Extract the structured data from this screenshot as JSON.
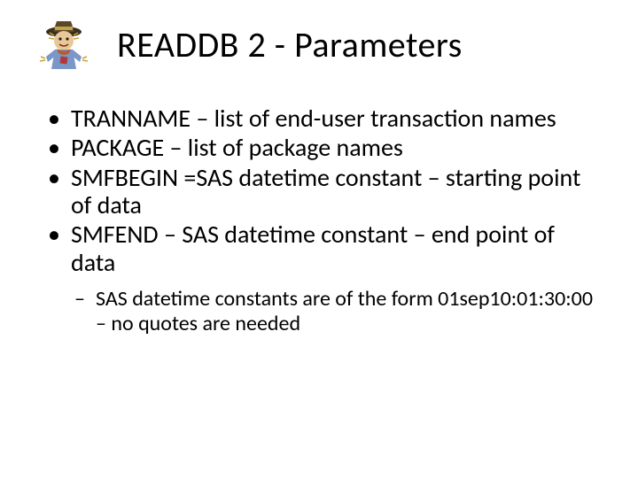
{
  "title": "READDB 2 - Parameters",
  "bullets": [
    "TRANNAME – list of end-user transaction names",
    "PACKAGE – list of package names",
    "SMFBEGIN =SAS datetime constant – starting point of data",
    "SMFEND – SAS datetime constant – end point of data"
  ],
  "subbullets": [
    "SAS datetime constants are of the form 01sep10:01:30:00 – no quotes are needed"
  ],
  "icon": "scarecrow-icon"
}
